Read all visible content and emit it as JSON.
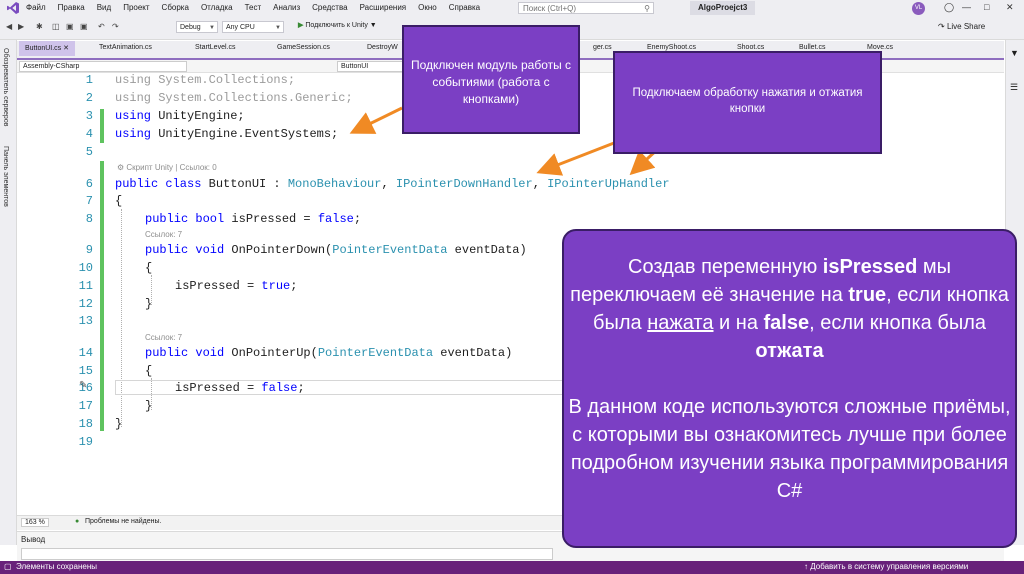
{
  "menubar": {
    "items": [
      "Файл",
      "Правка",
      "Вид",
      "Проект",
      "Сборка",
      "Отладка",
      "Тест",
      "Анализ",
      "Средства",
      "Расширения",
      "Окно",
      "Справка"
    ],
    "search_placeholder": "Поиск (Ctrl+Q)",
    "project_name": "AlgoProejct3",
    "user_initials": "VL"
  },
  "toolbar": {
    "config": "Debug",
    "platform": "Any CPU",
    "run_label": "Подключить к Unity",
    "live_share": "Live Share"
  },
  "left_strip": {
    "tab1": "Обозреватель серверов",
    "tab2": "Панель элементов"
  },
  "tabs": [
    "ButtonUI.cs",
    "TextAnimation.cs",
    "StartLevel.cs",
    "GameSession.cs",
    "DestroyW",
    "ger.cs",
    "EnemyShoot.cs",
    "Shoot.cs",
    "Bullet.cs",
    "Move.cs"
  ],
  "navbar": {
    "project": "Assembly-CSharp",
    "class": "ButtonUI"
  },
  "code": {
    "lines": [
      "1",
      "2",
      "3",
      "4",
      "5",
      "6",
      "7",
      "8",
      "9",
      "10",
      "11",
      "12",
      "13",
      "14",
      "15",
      "16",
      "17",
      "18",
      "19"
    ],
    "l1": "using System.Collections;",
    "l2": "using System.Collections.Generic;",
    "l3_kw": "using",
    "l3_rest": " UnityEngine;",
    "l4_kw": "using",
    "l4_rest": " UnityEngine.EventSystems;",
    "lens_class": "Скрипт Unity | Ссылок: 0",
    "l6_kw": "public class",
    "l6_name": " ButtonUI : ",
    "l6_t1": "MonoBehaviour",
    "l6_c1": ", ",
    "l6_t2": "IPointerDownHandler",
    "l6_c2": ", ",
    "l6_t3": "IPointerUpHandler",
    "l7": "{",
    "l8_kw": "public bool",
    "l8_mid": " isPressed = ",
    "l8_val": "false",
    "l8_end": ";",
    "lens_down": "Ссылок: 7",
    "l9_kw": "public void",
    "l9_mid": " OnPointerDown(",
    "l9_ty": "PointerEventData",
    "l9_end": " eventData)",
    "l10": "{",
    "l11_mid": "isPressed = ",
    "l11_val": "true",
    "l11_end": ";",
    "l12": "}",
    "lens_up": "Ссылок: 7",
    "l14_kw": "public void",
    "l14_mid": " OnPointerUp(",
    "l14_ty": "PointerEventData",
    "l14_end": " eventData)",
    "l15": "{",
    "l16_mid": "isPressed = ",
    "l16_val": "false",
    "l16_end": ";",
    "l17": "}",
    "l18": "}"
  },
  "editor_status": {
    "zoom": "163 %",
    "problems": "Проблемы не найдены."
  },
  "output": {
    "title": "Вывод"
  },
  "statusbar": {
    "left": "Элементы сохранены",
    "right": "Добавить в систему управления версиями"
  },
  "callouts": {
    "c1": "Подключен модуль работы с событиями (работа с кнопками)",
    "c2": "Подключаем обработку нажатия и отжатия кнопки",
    "c3_p1_a": "Создав переменную ",
    "c3_p1_b": "isPressed",
    "c3_p1_c": " мы переключаем её значение на ",
    "c3_p1_d": "true",
    "c3_p1_e": ", если кнопка была ",
    "c3_p1_f": "нажата",
    "c3_p1_g": " и на ",
    "c3_p1_h": "false",
    "c3_p1_i": ", если кнопка была ",
    "c3_p1_j": "отжата",
    "c3_p2": "В данном коде используются сложные приёмы, с которыми вы ознакомитесь лучше при более подробном изучении языка программирования C#"
  },
  "colors": {
    "callout": "#7b3fc4",
    "keyword": "#0000ff",
    "type": "#2b91af",
    "statusbar": "#68217a",
    "arrow": "#f08a24"
  }
}
